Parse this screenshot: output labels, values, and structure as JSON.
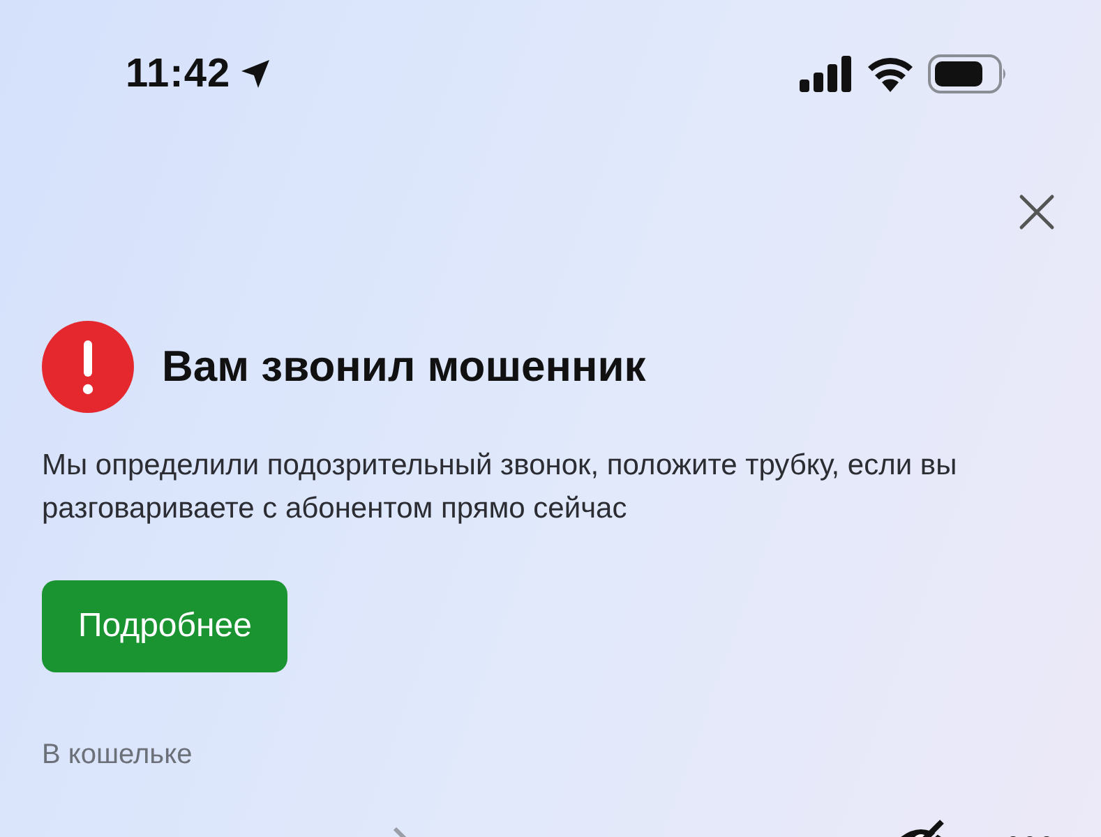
{
  "status_bar": {
    "time": "11:42"
  },
  "alert": {
    "title": "Вам звонил мошенник",
    "message": "Мы определили подозрительный звонок, положите трубку, если вы разговариваете с абонентом прямо сейчас",
    "button": "Подробнее"
  },
  "wallet": {
    "label": "В кошельке"
  }
}
